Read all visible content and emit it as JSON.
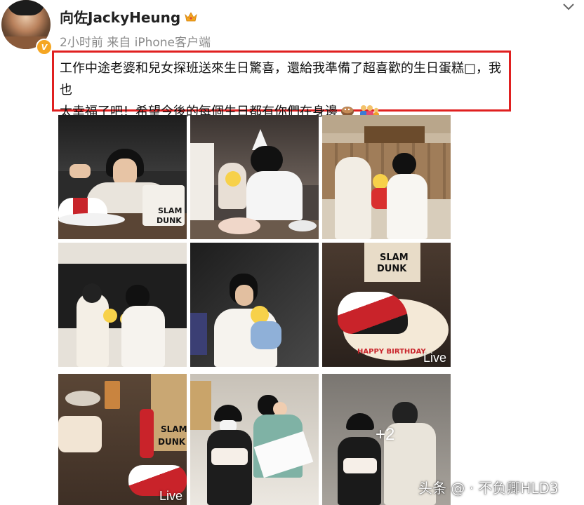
{
  "header": {
    "username": "向佐JackyHeung",
    "meta": "2小时前  来自 iPhone客户端",
    "verified_badge": "V",
    "username_icon": "crown-icon",
    "menu_icon": "chevron-down-icon"
  },
  "post": {
    "line1": "工作中途老婆和兒女探班送來生日驚喜，還給我準備了超喜歡的生日蛋糕",
    "line1_tail": "，我也",
    "line2": "太幸福了吧！希望今後的每個生日都有你們在身邊",
    "missing_glyph": "□",
    "emojis": [
      "cake-emoji",
      "family-emoji"
    ],
    "highlight_color": "#e02020"
  },
  "photos": [
    {
      "id": "p1",
      "badge": ""
    },
    {
      "id": "p2",
      "badge": ""
    },
    {
      "id": "p3",
      "badge": ""
    },
    {
      "id": "p4",
      "badge": ""
    },
    {
      "id": "p5",
      "badge": ""
    },
    {
      "id": "p6",
      "badge": "Live"
    },
    {
      "id": "p7",
      "badge": "Live"
    },
    {
      "id": "p8",
      "badge": ""
    },
    {
      "id": "p9",
      "badge": "+2"
    }
  ],
  "cake_text": {
    "slam": "SLAM",
    "dunk": "DUNK",
    "happy_birthday": "HAPPY BIRTHDAY"
  },
  "watermark": "头条 @ · 不负卿HLD3"
}
